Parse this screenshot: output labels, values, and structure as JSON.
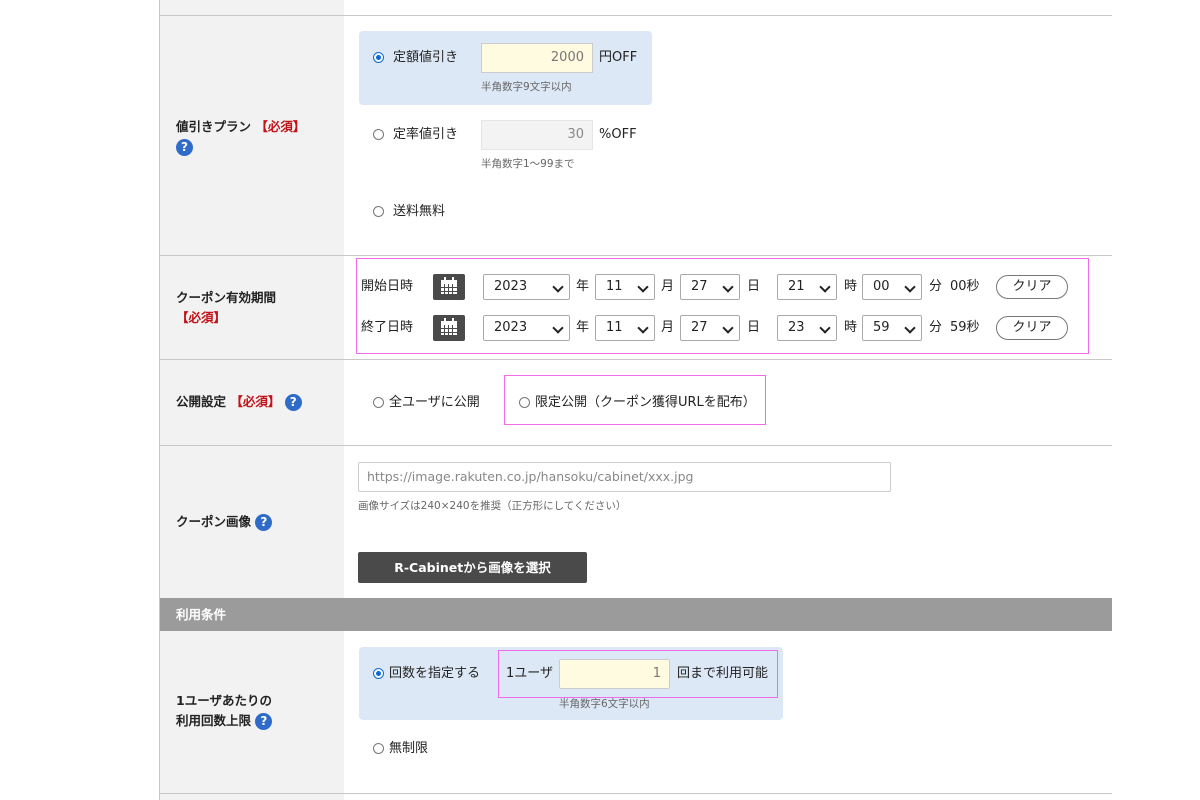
{
  "discount_plan": {
    "label": "値引きプラン",
    "required": "【必須】",
    "help": "?",
    "options": [
      {
        "label": "定額値引き",
        "value": "2000",
        "unit": "円OFF",
        "note": "半角数字9文字以内",
        "selected": true
      },
      {
        "label": "定率値引き",
        "value": "30",
        "unit": "%OFF",
        "note": "半角数字1～99まで",
        "selected": false
      },
      {
        "label": "送料無料",
        "selected": false
      }
    ]
  },
  "validity": {
    "label": "クーポン有効期間",
    "required": "【必須】",
    "start": {
      "label": "開始日時",
      "year": "2023",
      "month": "11",
      "day": "27",
      "hour": "21",
      "minute": "00",
      "seconds": "00秒"
    },
    "end": {
      "label": "終了日時",
      "year": "2023",
      "month": "11",
      "day": "27",
      "hour": "23",
      "minute": "59",
      "seconds": "59秒"
    },
    "units": {
      "year": "年",
      "month": "月",
      "day": "日",
      "hour": "時",
      "minute": "分"
    },
    "clear_label": "クリア"
  },
  "visibility": {
    "label": "公開設定",
    "required": "【必須】",
    "help": "?",
    "options": [
      {
        "label": "全ユーザに公開",
        "selected": false
      },
      {
        "label": "限定公開（クーポン獲得URLを配布）",
        "selected": false
      }
    ]
  },
  "coupon_image": {
    "label": "クーポン画像",
    "help": "?",
    "placeholder": "https://image.rakuten.co.jp/hansoku/cabinet/xxx.jpg",
    "note": "画像サイズは240×240を推奨（正方形にしてください）",
    "button": "R-Cabinetから画像を選択"
  },
  "section_header": "利用条件",
  "usage_limit": {
    "label_line1": "1ユーザあたりの",
    "label_line2": "利用回数上限",
    "help": "?",
    "options": [
      {
        "label": "回数を指定する",
        "selected": true
      },
      {
        "label": "無制限",
        "selected": false
      }
    ],
    "prefix": "1ユーザ",
    "value": "1",
    "suffix": "回まで利用可能",
    "note": "半角数字6文字以内"
  },
  "colors": {
    "highlight_bg": "#dde8f7",
    "input_bg": "#fffbe0",
    "disabled_bg": "#f3f3f3",
    "required": "#c0141a",
    "help": "#2f6cc9",
    "annotation": "#f06be8",
    "section_header_bg": "#9b9b9b",
    "button_bg": "#4a4a4a"
  },
  "icons": [
    "radio-selected-icon",
    "radio-unselected-icon",
    "calendar-icon",
    "help-icon",
    "chevron-down-icon"
  ]
}
